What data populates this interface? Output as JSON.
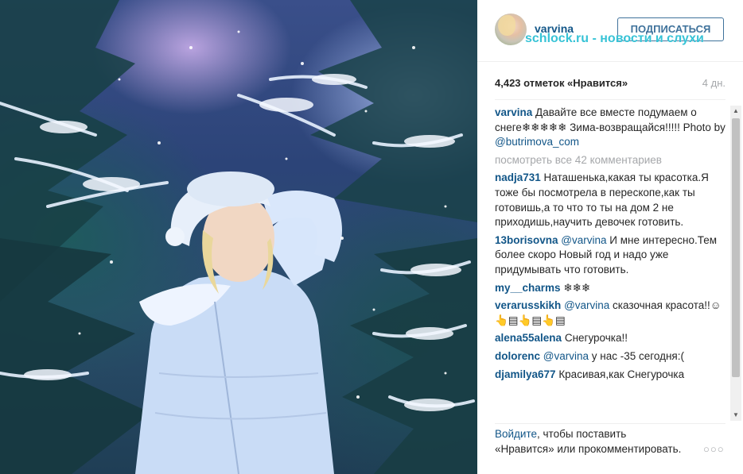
{
  "post": {
    "photo_description": "",
    "username": "varvina",
    "follow_label": "ПОДПИСАТЬСЯ",
    "watermark": "schlock.ru - новости и слухи",
    "likes": "4,423 отметок «Нравится»",
    "time_ago": "4 дн.",
    "caption": {
      "user": "varvina",
      "text_before": " Давайте все вместе подумаем о снеге❄❄❄❄❄ Зима-возвращайся!!!!! Photo by ",
      "mention": "@butrimova_com"
    },
    "view_all": "посмотреть все 42 комментариев"
  },
  "comments": [
    {
      "user": "nadja731",
      "mention": "",
      "text": " Наташенька,какая ты красотка.Я тоже бы посмотрела в перескопе,как ты готовишь,а то что то ты на дом 2 не приходишь,научить девочек готовить."
    },
    {
      "user": "13borisovna",
      "mention": " @varvina",
      "text": " И мне интересно.Тем более скоро Новый год и надо уже придумывать что готовить."
    },
    {
      "user": "my__charms",
      "mention": "",
      "text": " ❄❄❄"
    },
    {
      "user": "verarusskikh",
      "mention": " @varvina",
      "text": " сказочная красота!!☺👆▤👆▤👆▤"
    },
    {
      "user": "alena55alena",
      "mention": "",
      "text": " Снегурочка!!"
    },
    {
      "user": "dolorenc",
      "mention": " @varvina",
      "text": " у нас -35 сегодня:("
    },
    {
      "user": "djamilya677",
      "mention": "",
      "text": " Красивая,как Снегурочка"
    }
  ],
  "footer": {
    "login_link": "Войдите",
    "text": ", чтобы поставить «Нравится» или прокомментировать.",
    "more_icon": "ellipsis-icon"
  },
  "colors": {
    "link": "#125688",
    "follow_border": "#3f729b",
    "muted": "#a5a7aa",
    "watermark": "#37c3d6"
  }
}
